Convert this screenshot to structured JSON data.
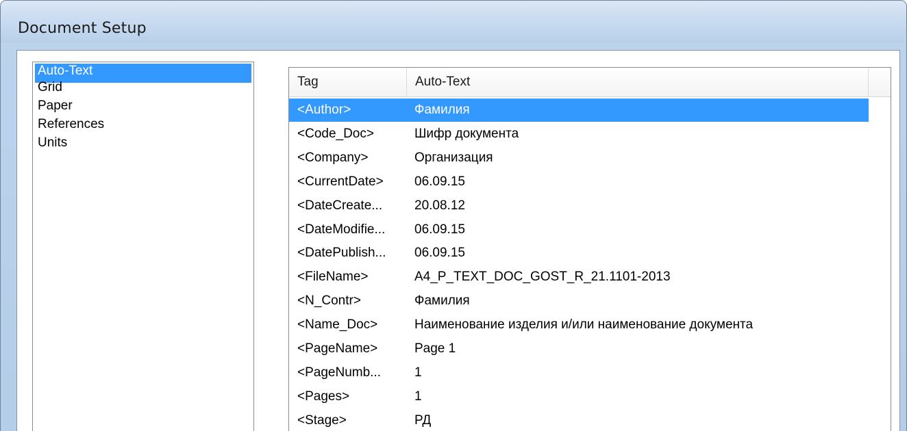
{
  "window": {
    "title": "Document Setup"
  },
  "categories": [
    {
      "label": "Auto-Text",
      "selected": true
    },
    {
      "label": "Grid",
      "selected": false
    },
    {
      "label": "Paper",
      "selected": false
    },
    {
      "label": "References",
      "selected": false
    },
    {
      "label": "Units",
      "selected": false
    }
  ],
  "table": {
    "columns": [
      "Tag",
      "Auto-Text"
    ],
    "rows": [
      {
        "tag": "<Author>",
        "text": "Фамилия",
        "selected": true
      },
      {
        "tag": "<Code_Doc>",
        "text": "Шифр документа",
        "selected": false
      },
      {
        "tag": "<Company>",
        "text": "Организация",
        "selected": false
      },
      {
        "tag": "<CurrentDate>",
        "text": "06.09.15",
        "selected": false
      },
      {
        "tag": "<DateCreate...",
        "text": "20.08.12",
        "selected": false
      },
      {
        "tag": "<DateModifie...",
        "text": "06.09.15",
        "selected": false
      },
      {
        "tag": "<DatePublish...",
        "text": "06.09.15",
        "selected": false
      },
      {
        "tag": "<FileName>",
        "text": "A4_P_TEXT_DOC_GOST_R_21.1101-2013",
        "selected": false
      },
      {
        "tag": "<N_Contr>",
        "text": "Фамилия",
        "selected": false
      },
      {
        "tag": "<Name_Doc>",
        "text": "Наименование изделия и/или наименование документа",
        "selected": false
      },
      {
        "tag": "<PageName>",
        "text": "Page 1",
        "selected": false
      },
      {
        "tag": "<PageNumb...",
        "text": "1",
        "selected": false
      },
      {
        "tag": "<Pages>",
        "text": "1",
        "selected": false
      },
      {
        "tag": "<Stage>",
        "text": "РД",
        "selected": false
      }
    ]
  },
  "colors": {
    "selection": "#3399ff",
    "titlebar": "#c6d9ef"
  }
}
